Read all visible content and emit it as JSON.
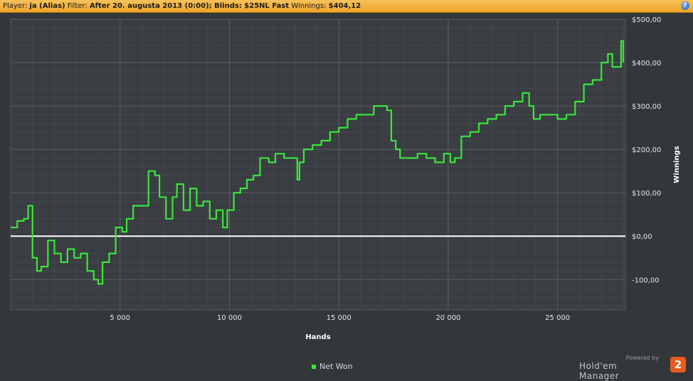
{
  "header": {
    "player_label": "Player:",
    "player_value": "ja (Alias)",
    "filter_label": "Filter:",
    "filter_value": "After 20. augusta 2013 (0:00); Blinds: $25NL Fast",
    "winnings_label": "Winnings:",
    "winnings_value": "$404,12",
    "help_icon": "?"
  },
  "brand": {
    "powered": "Powered by",
    "name": "Hold'em Manager",
    "logo": "2"
  },
  "colors": {
    "background": "#33373a",
    "plot_background": "#3a3e42",
    "series": "#39e63c",
    "zero_line": "#ffffff",
    "header_orange": "#f0a830"
  },
  "chart_data": {
    "type": "line",
    "xlabel": "Hands",
    "ylabel": "Winnings",
    "xlim": [
      0,
      28100
    ],
    "ylim": [
      -170,
      500
    ],
    "x_ticks": [
      5000,
      10000,
      15000,
      20000,
      25000
    ],
    "x_tick_labels": [
      "5 000",
      "10 000",
      "15 000",
      "20 000",
      "25 000"
    ],
    "y_ticks": [
      -100,
      0,
      100,
      200,
      300,
      400,
      500
    ],
    "y_tick_labels": [
      "-100,00",
      "$0,00",
      "$100,00",
      "$200,00",
      "$300,00",
      "$400,00",
      "$500,00"
    ],
    "grid": true,
    "legend": "bottom-center",
    "series": [
      {
        "name": "Net Won",
        "x": [
          0,
          300,
          600,
          800,
          1000,
          1200,
          1400,
          1700,
          2000,
          2300,
          2600,
          2900,
          3200,
          3500,
          3800,
          4000,
          4200,
          4500,
          4800,
          5100,
          5300,
          5600,
          6000,
          6300,
          6600,
          6800,
          7100,
          7400,
          7600,
          7900,
          8200,
          8500,
          8800,
          9100,
          9400,
          9700,
          9900,
          10200,
          10500,
          10800,
          11100,
          11400,
          11800,
          12100,
          12500,
          12800,
          13100,
          13200,
          13400,
          13800,
          14200,
          14600,
          15000,
          15400,
          15800,
          16200,
          16600,
          16900,
          17200,
          17400,
          17600,
          17800,
          18200,
          18600,
          19000,
          19400,
          19800,
          20100,
          20300,
          20600,
          21000,
          21400,
          21800,
          22200,
          22600,
          23000,
          23400,
          23700,
          23900,
          24200,
          24600,
          25000,
          25400,
          25800,
          26200,
          26600,
          27000,
          27300,
          27500,
          27800,
          27900,
          28000
        ],
        "y": [
          20,
          35,
          40,
          70,
          -50,
          -80,
          -70,
          -10,
          -40,
          -60,
          -30,
          -50,
          -40,
          -80,
          -100,
          -110,
          -60,
          -40,
          20,
          10,
          40,
          70,
          70,
          150,
          140,
          90,
          40,
          90,
          120,
          60,
          110,
          70,
          80,
          40,
          60,
          20,
          60,
          100,
          110,
          130,
          140,
          180,
          170,
          190,
          180,
          180,
          130,
          170,
          200,
          210,
          220,
          240,
          250,
          270,
          280,
          280,
          300,
          300,
          290,
          220,
          200,
          180,
          180,
          190,
          180,
          170,
          190,
          170,
          180,
          230,
          240,
          260,
          270,
          280,
          300,
          310,
          330,
          300,
          270,
          280,
          280,
          270,
          280,
          310,
          350,
          360,
          400,
          420,
          390,
          390,
          450,
          400
        ]
      }
    ]
  }
}
